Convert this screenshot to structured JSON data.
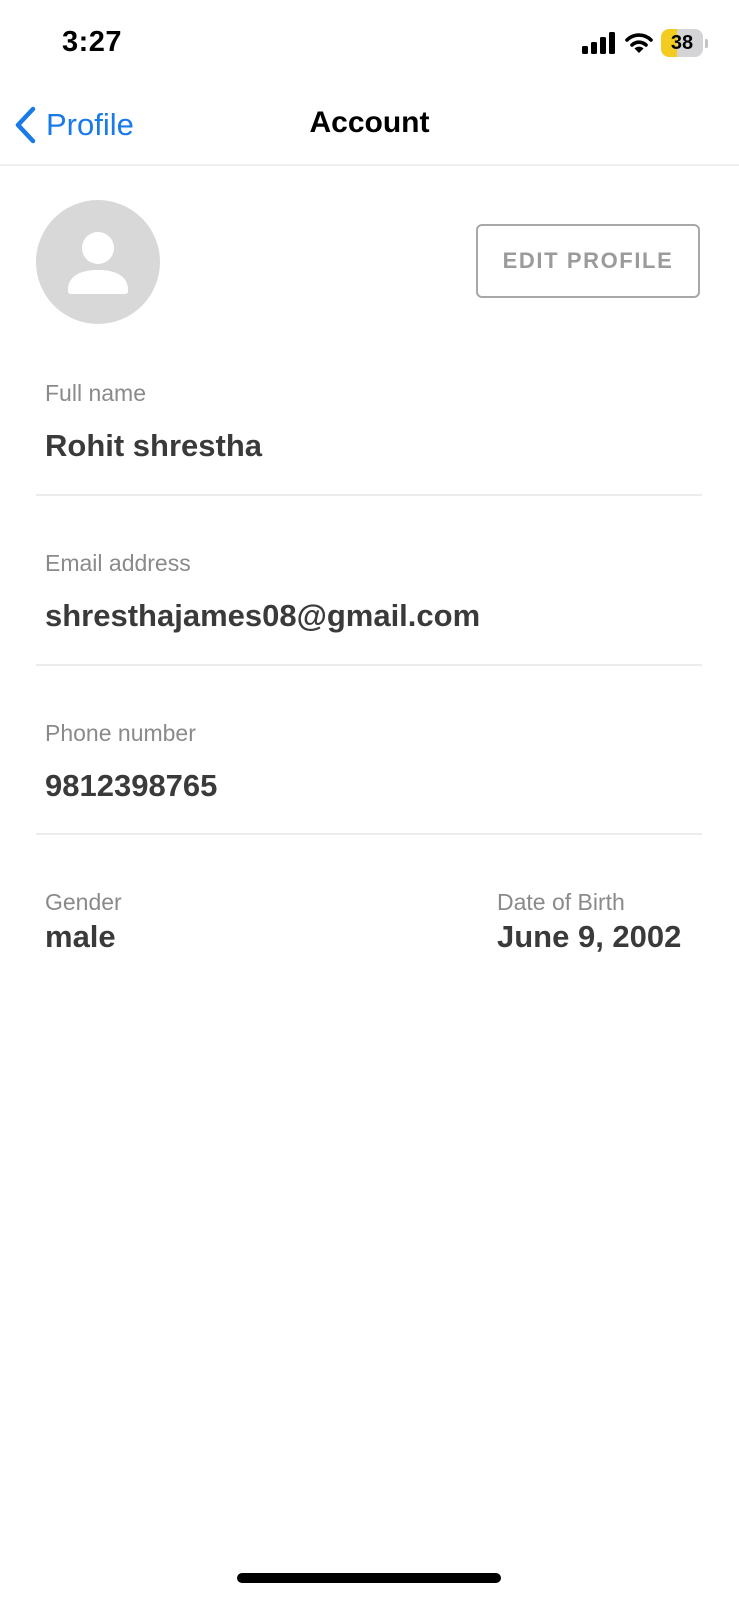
{
  "status_bar": {
    "time": "3:27",
    "battery_level": "38",
    "battery_fraction": 0.38,
    "battery_fill_color": "#f4cc20"
  },
  "nav": {
    "back_label": "Profile",
    "title": "Account",
    "accent_color": "#1a7ae8"
  },
  "profile": {
    "avatar_icon": "person-icon",
    "edit_button_label": "EDIT PROFILE"
  },
  "fields": {
    "full_name": {
      "label": "Full name",
      "value": "Rohit shrestha"
    },
    "email": {
      "label": "Email address",
      "value": "shresthajames08@gmail.com"
    },
    "phone": {
      "label": "Phone number",
      "value": "9812398765"
    },
    "gender": {
      "label": "Gender",
      "value": "male"
    },
    "dob": {
      "label": "Date of Birth",
      "value": "June 9, 2002"
    }
  }
}
